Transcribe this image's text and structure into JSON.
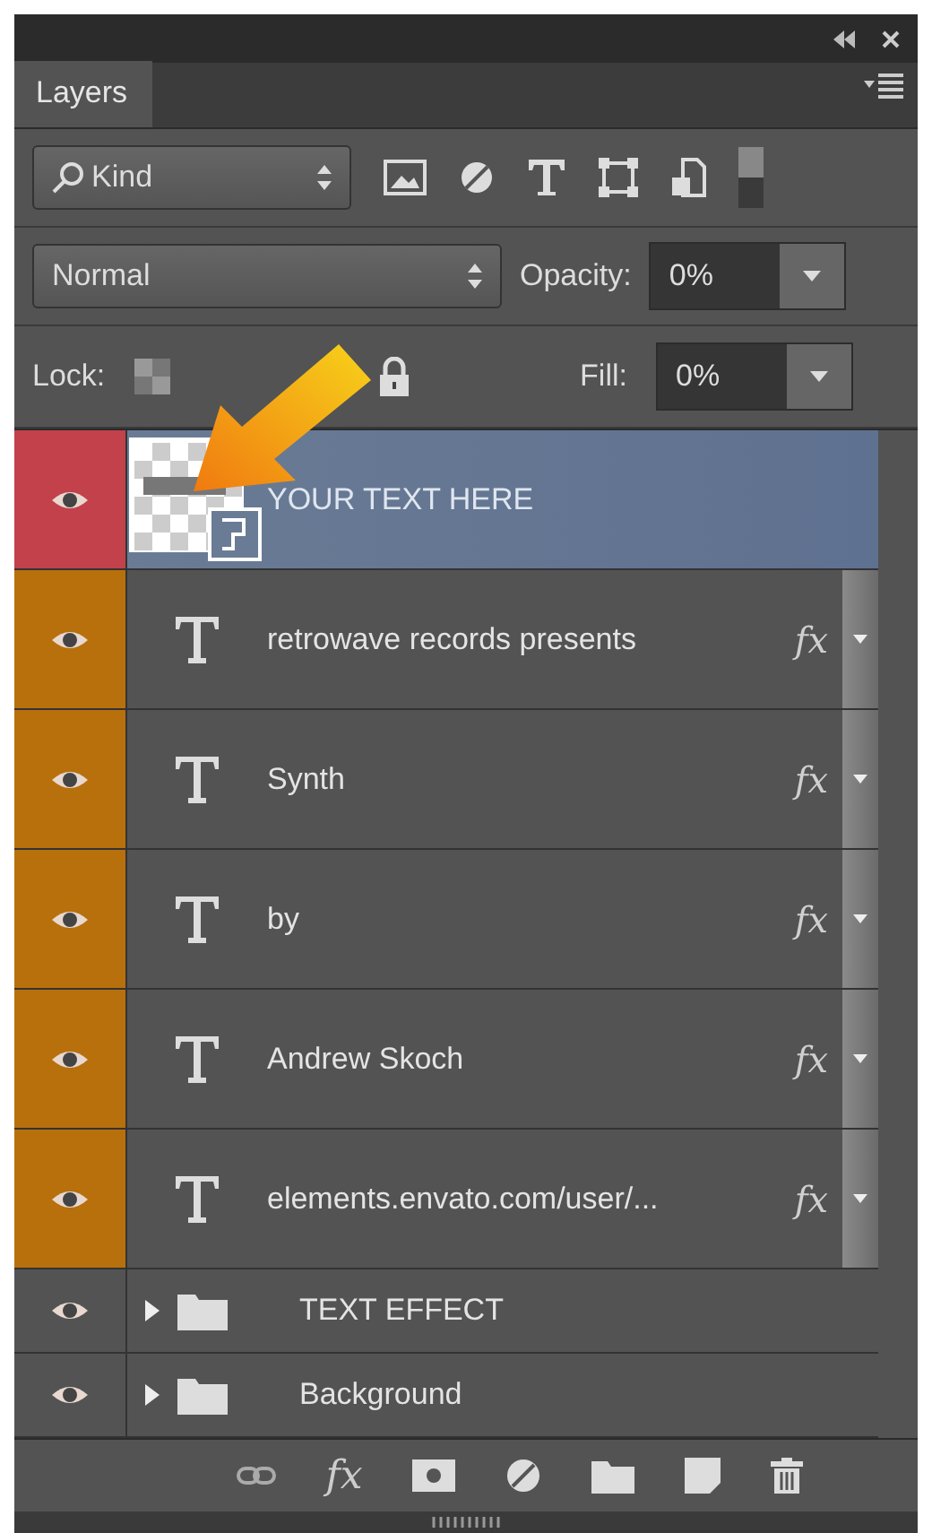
{
  "panel": {
    "tab": "Layers"
  },
  "filter": {
    "value": "Kind"
  },
  "blend_mode": {
    "value": "Normal"
  },
  "opacity": {
    "label": "Opacity:",
    "value": "0%"
  },
  "lock": {
    "label": "Lock:"
  },
  "fill": {
    "label": "Fill:",
    "value": "0%"
  },
  "layers": [
    {
      "kind": "smart",
      "name": "YOUR TEXT HERE",
      "selected": true,
      "color": "#c2414b"
    },
    {
      "kind": "text",
      "name": "retrowave records presents",
      "selected": false,
      "color": "#b8700c",
      "effects": "fx"
    },
    {
      "kind": "text",
      "name": "Synth",
      "selected": false,
      "color": "#b8700c",
      "effects": "fx"
    },
    {
      "kind": "text",
      "name": "by",
      "selected": false,
      "color": "#b8700c",
      "effects": "fx"
    },
    {
      "kind": "text",
      "name": "Andrew Skoch",
      "selected": false,
      "color": "#b8700c",
      "effects": "fx"
    },
    {
      "kind": "text",
      "name": "elements.envato.com/user/...",
      "selected": false,
      "color": "#b8700c",
      "effects": "fx"
    },
    {
      "kind": "group",
      "name": "TEXT EFFECT",
      "selected": false
    },
    {
      "kind": "group",
      "name": "Background",
      "selected": false
    }
  ],
  "footer": {
    "fx_label": "fx"
  }
}
